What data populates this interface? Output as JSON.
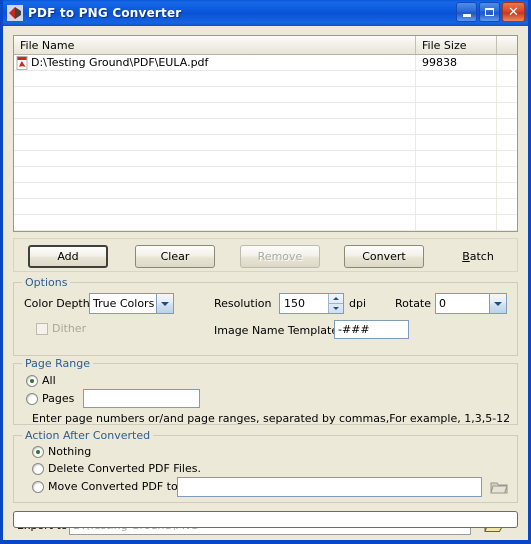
{
  "window": {
    "title": "PDF to PNG Converter",
    "icon": "app-logo-icon",
    "controls": {
      "minimize": "minimize-icon",
      "maximize": "maximize-icon",
      "close": "close-icon"
    }
  },
  "file_list": {
    "columns": [
      "File Name",
      "File Size",
      ""
    ],
    "rows": [
      {
        "icon": "pdf-file-icon",
        "name": "D:\\Testing Ground\\PDF\\EULA.pdf",
        "size": "99838",
        "extra": ""
      }
    ],
    "empty_row_count": 11
  },
  "toolbar": {
    "add_label": "Add",
    "clear_label": "Clear",
    "remove_label": "Remove",
    "convert_label": "Convert",
    "batch_label": "Batch",
    "batch_accel": "B",
    "batch_rest": "atch"
  },
  "options": {
    "title": "Options",
    "color_depth_label": "Color Depth",
    "color_depth_value": "True Colors",
    "dither_label": "Dither",
    "dither_checked": false,
    "resolution_label": "Resolution",
    "resolution_value": "150",
    "resolution_unit": "dpi",
    "rotate_label": "Rotate",
    "rotate_value": "0",
    "image_name_template_label": "Image Name Template",
    "image_name_template_value": "-###"
  },
  "page_range": {
    "title": "Page Range",
    "all_label": "All",
    "pages_label": "Pages",
    "pages_value": "",
    "selected": "All",
    "hint": "Enter page numbers or/and page ranges, separated by commas,For example,  1,3,5-12"
  },
  "action_after": {
    "title": "Action After Converted",
    "nothing_label": "Nothing",
    "delete_label": "Delete Converted PDF Files.",
    "move_label": "Move Converted PDF to",
    "move_path_value": "",
    "selected": "Nothing",
    "browse_icon": "folder-open-icon-disabled"
  },
  "export": {
    "label": "Export to",
    "path_value": "D:\\Testing Ground\\PNG",
    "browse_icon": "folder-open-icon"
  },
  "status": {
    "progress_percent": 0
  },
  "colors": {
    "titlebar_blue": "#0a55d8",
    "window_border": "#0a46c8",
    "dialog_face": "#ece9d8",
    "group_title": "#2d5c8f",
    "field_border": "#7f9db9",
    "radio_dot": "#2f7a2f",
    "folder_yellow": "#d8c87a"
  }
}
